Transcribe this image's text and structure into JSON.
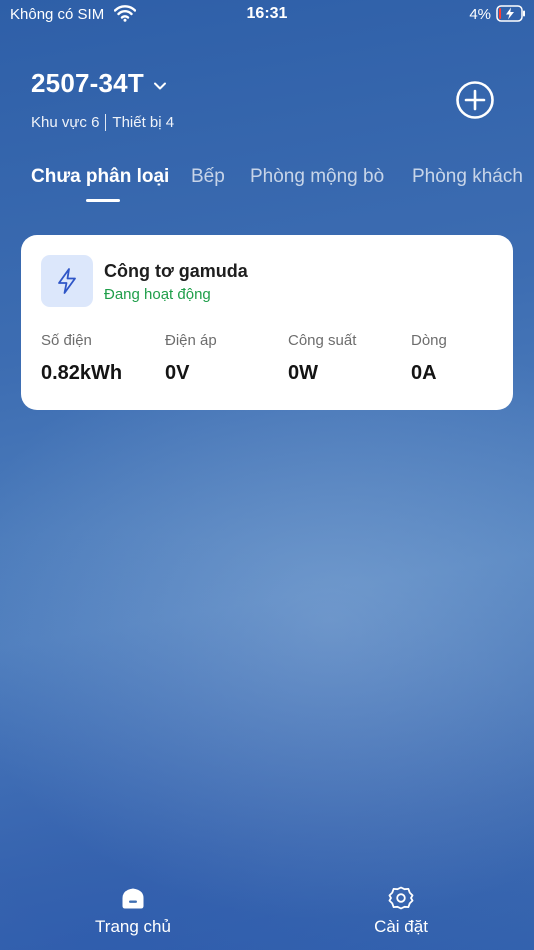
{
  "status_bar": {
    "carrier": "Không có SIM",
    "time": "16:31",
    "battery": "4%"
  },
  "header": {
    "title": "2507-34T",
    "area": "Khu vực 6",
    "devices": "Thiết bị 4"
  },
  "tabs": [
    {
      "label": "Chưa phân loại",
      "active": true
    },
    {
      "label": "Bếp",
      "active": false
    },
    {
      "label": "Phòng mộng bò",
      "active": false
    },
    {
      "label": "Phòng khách",
      "active": false
    }
  ],
  "device_card": {
    "name": "Công tơ gamuda",
    "status": "Đang hoạt động",
    "metrics": [
      {
        "label": "Số điện",
        "value": "0.82kWh"
      },
      {
        "label": "Điện áp",
        "value": "0V"
      },
      {
        "label": "Công suất",
        "value": "0W"
      },
      {
        "label": "Dòng",
        "value": "0A"
      }
    ]
  },
  "bottom_nav": [
    {
      "label": "Trang chủ",
      "icon": "home-icon"
    },
    {
      "label": "Cài đặt",
      "icon": "gear-icon"
    }
  ],
  "colors": {
    "background": "#3f6fb3",
    "status_green": "#1f9e4a",
    "icon_tile": "#dce7fb",
    "icon_stroke": "#2f56c7"
  }
}
